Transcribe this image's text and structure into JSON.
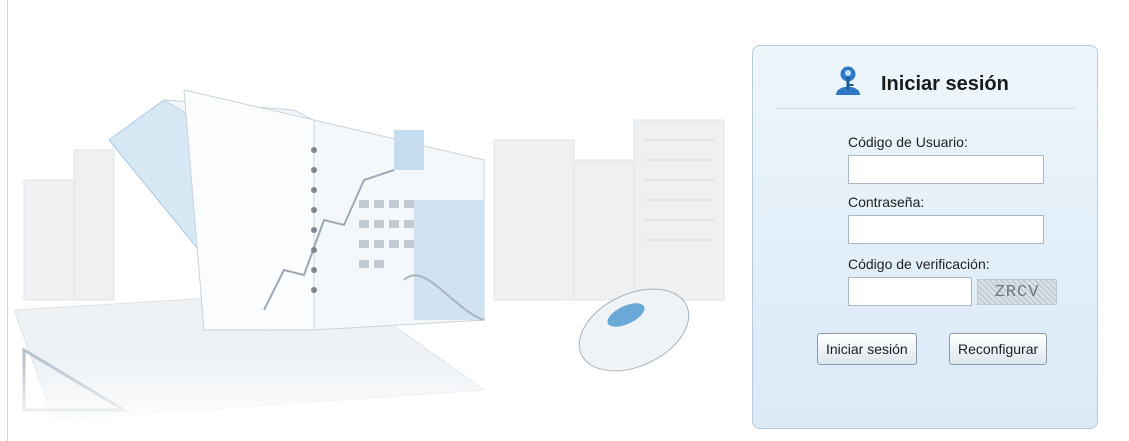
{
  "login": {
    "title": "Iniciar sesión",
    "username_label": "Código de Usuario:",
    "username_value": "",
    "password_label": "Contraseña:",
    "password_value": "",
    "verification_label": "Código de verificación:",
    "verification_value": "",
    "captcha_text": "ZRCV",
    "submit_label": "Iniciar sesión",
    "reset_label": "Reconfigurar"
  },
  "icons": {
    "title_icon": "key-user-icon"
  },
  "colors": {
    "panel_bg": "#e1eef8",
    "panel_border": "#b7cbdd",
    "icon_blue": "#2e78c5"
  }
}
